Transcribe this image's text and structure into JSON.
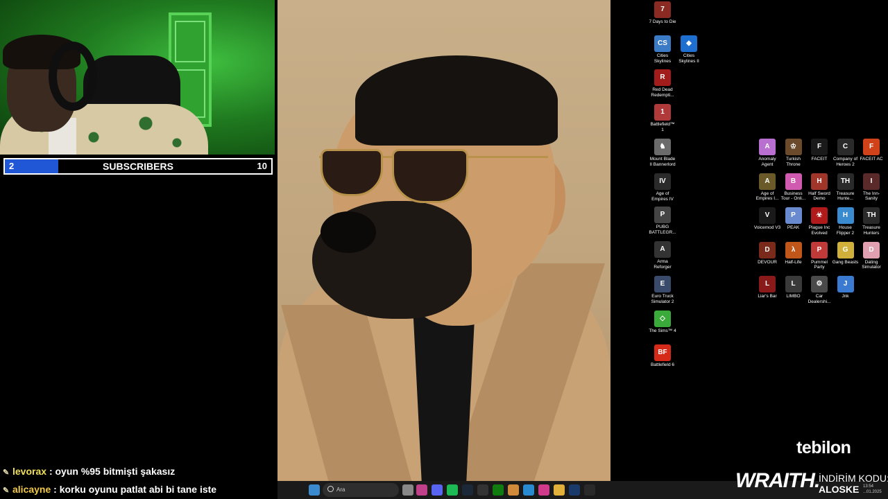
{
  "subscribers": {
    "current": "2",
    "label": "SUBSCRIBERS",
    "goal": "10",
    "progress_fraction": 0.2
  },
  "chat": [
    {
      "user": "levorax",
      "message": ": oyun %95 bitmişti şakasız"
    },
    {
      "user": "alicayne",
      "message": ": korku oyunu patlat abi bi tane iste"
    }
  ],
  "desktop_left": [
    {
      "label": "7 Days to Die",
      "icon": "7days-icon",
      "color": "#8a2a22",
      "glyph": "7"
    },
    {
      "label": "Cities Skylines",
      "icon": "cities-icon",
      "color": "#3b7ac4",
      "glyph": "CS"
    },
    {
      "label": "Cities Skylines II",
      "icon": "cities2-icon",
      "color": "#1f6fd1",
      "glyph": "◆"
    },
    {
      "label": "Red Dead Redempti...",
      "icon": "rdr-icon",
      "color": "#a31c1c",
      "glyph": "R"
    },
    {
      "label": "Battlefield™ 1",
      "icon": "bf1-icon",
      "color": "#b03a3a",
      "glyph": "1"
    },
    {
      "label": "Mount  Blade II Bannerlord",
      "icon": "bannerlord-icon",
      "color": "#6b6b6b",
      "glyph": "♞"
    },
    {
      "label": "Age of Empires IV",
      "icon": "aoe4-icon",
      "color": "#2a2a2a",
      "glyph": "IV"
    },
    {
      "label": "PUBG BATTLEGR...",
      "icon": "pubg-icon",
      "color": "#444",
      "glyph": "P"
    },
    {
      "label": "Arma Reforger",
      "icon": "arma-icon",
      "color": "#333",
      "glyph": "A"
    },
    {
      "label": "Euro Truck Simulator 2",
      "icon": "ets2-icon",
      "color": "#3a4a6a",
      "glyph": "E"
    },
    {
      "label": "The Sims™ 4",
      "icon": "sims-icon",
      "color": "#3aaa3a",
      "glyph": "◇"
    },
    {
      "label": "Battlefield 6",
      "icon": "bf6-icon",
      "color": "#d52a1a",
      "glyph": "BF"
    }
  ],
  "desktop_grid": [
    {
      "label": "Anomaly Agent",
      "icon": "anomaly-icon",
      "color": "#b86fd0",
      "glyph": "A"
    },
    {
      "label": "Turkish Throne",
      "icon": "throne-icon",
      "color": "#6a4a2a",
      "glyph": "♔"
    },
    {
      "label": "FACEIT",
      "icon": "faceit-icon",
      "color": "#1a1a1a",
      "glyph": "F"
    },
    {
      "label": "Company of Heroes 2",
      "icon": "coh2-icon",
      "color": "#2a2a2a",
      "glyph": "C"
    },
    {
      "label": "FACEIT AC",
      "icon": "faceit-ac-icon",
      "color": "#d0431a",
      "glyph": "F"
    },
    {
      "label": "Age of Empires I...",
      "icon": "aoe-icon",
      "color": "#6a5a2a",
      "glyph": "A"
    },
    {
      "label": "Business Tour - Onli...",
      "icon": "business-icon",
      "color": "#d05ab0",
      "glyph": "B"
    },
    {
      "label": "Half Sword Demo",
      "icon": "halfsword-icon",
      "color": "#a0362a",
      "glyph": "H"
    },
    {
      "label": "Treasure Hunte...",
      "icon": "treasure-icon",
      "color": "#2a2a2a",
      "glyph": "TH"
    },
    {
      "label": "The Inn-Sanity",
      "icon": "inn-icon",
      "color": "#5a2a2a",
      "glyph": "I"
    },
    {
      "label": "Voicemod V3",
      "icon": "voicemod-icon",
      "color": "#1a1a1a",
      "glyph": "V"
    },
    {
      "label": "PEAK",
      "icon": "peak-icon",
      "color": "#6a8ad0",
      "glyph": "P"
    },
    {
      "label": "Plague Inc Evolved",
      "icon": "plague-icon",
      "color": "#b01a1a",
      "glyph": "☣"
    },
    {
      "label": "House Flipper 2",
      "icon": "house-icon",
      "color": "#3a8ad0",
      "glyph": "H"
    },
    {
      "label": "Treasure Hunters",
      "icon": "treasure2-icon",
      "color": "#2a2a2a",
      "glyph": "TH"
    },
    {
      "label": "DEVOUR",
      "icon": "devour-icon",
      "color": "#7a2a1a",
      "glyph": "D"
    },
    {
      "label": "Half-Life",
      "icon": "halflife-icon",
      "color": "#c0561a",
      "glyph": "λ"
    },
    {
      "label": "Pummel Party",
      "icon": "pummel-icon",
      "color": "#c03a3a",
      "glyph": "P"
    },
    {
      "label": "Gang Beasts",
      "icon": "gang-icon",
      "color": "#d0b03a",
      "glyph": "G"
    },
    {
      "label": "Dating Simulator",
      "icon": "dating-icon",
      "color": "#e0a0b0",
      "glyph": "D"
    },
    {
      "label": "Liar's Bar",
      "icon": "liars-icon",
      "color": "#8a1a1a",
      "glyph": "L"
    },
    {
      "label": "LIMBO",
      "icon": "limbo-icon",
      "color": "#3a3a3a",
      "glyph": "L"
    },
    {
      "label": "Car Dealershi...",
      "icon": "car-icon",
      "color": "#4a4a4a",
      "glyph": "⚙"
    },
    {
      "label": "Jnk",
      "icon": "jnk-icon",
      "color": "#3a7ad0",
      "glyph": "J"
    }
  ],
  "taskbar": {
    "search_placeholder": "Ara",
    "apps": [
      {
        "icon": "windows-start-icon",
        "color": "#3a8ad0"
      },
      {
        "icon": "task-view-icon",
        "color": "#888"
      },
      {
        "icon": "app-pink-icon",
        "color": "#c0408a"
      },
      {
        "icon": "discord-icon",
        "color": "#5865f2"
      },
      {
        "icon": "spotify-icon",
        "color": "#1db954"
      },
      {
        "icon": "steam-icon",
        "color": "#1b2838"
      },
      {
        "icon": "epic-icon",
        "color": "#333"
      },
      {
        "icon": "xbox-icon",
        "color": "#107c10"
      },
      {
        "icon": "app-colorful-icon",
        "color": "#d08a3a"
      },
      {
        "icon": "edge-icon",
        "color": "#2a8ad0"
      },
      {
        "icon": "instagram-icon",
        "color": "#d03a8a"
      },
      {
        "icon": "explorer-icon",
        "color": "#e0b03a"
      },
      {
        "icon": "photoshop-icon",
        "color": "#1a3a6a"
      },
      {
        "icon": "obs-icon",
        "color": "#2a2a2a"
      }
    ]
  },
  "branding": {
    "tebilon": "tebilon",
    "wraith": "WRAITH.",
    "discount_label": "İNDİRİM KODU:",
    "discount_code": "ALOSKE",
    "time": "13:54",
    "date": "...01.2025"
  }
}
